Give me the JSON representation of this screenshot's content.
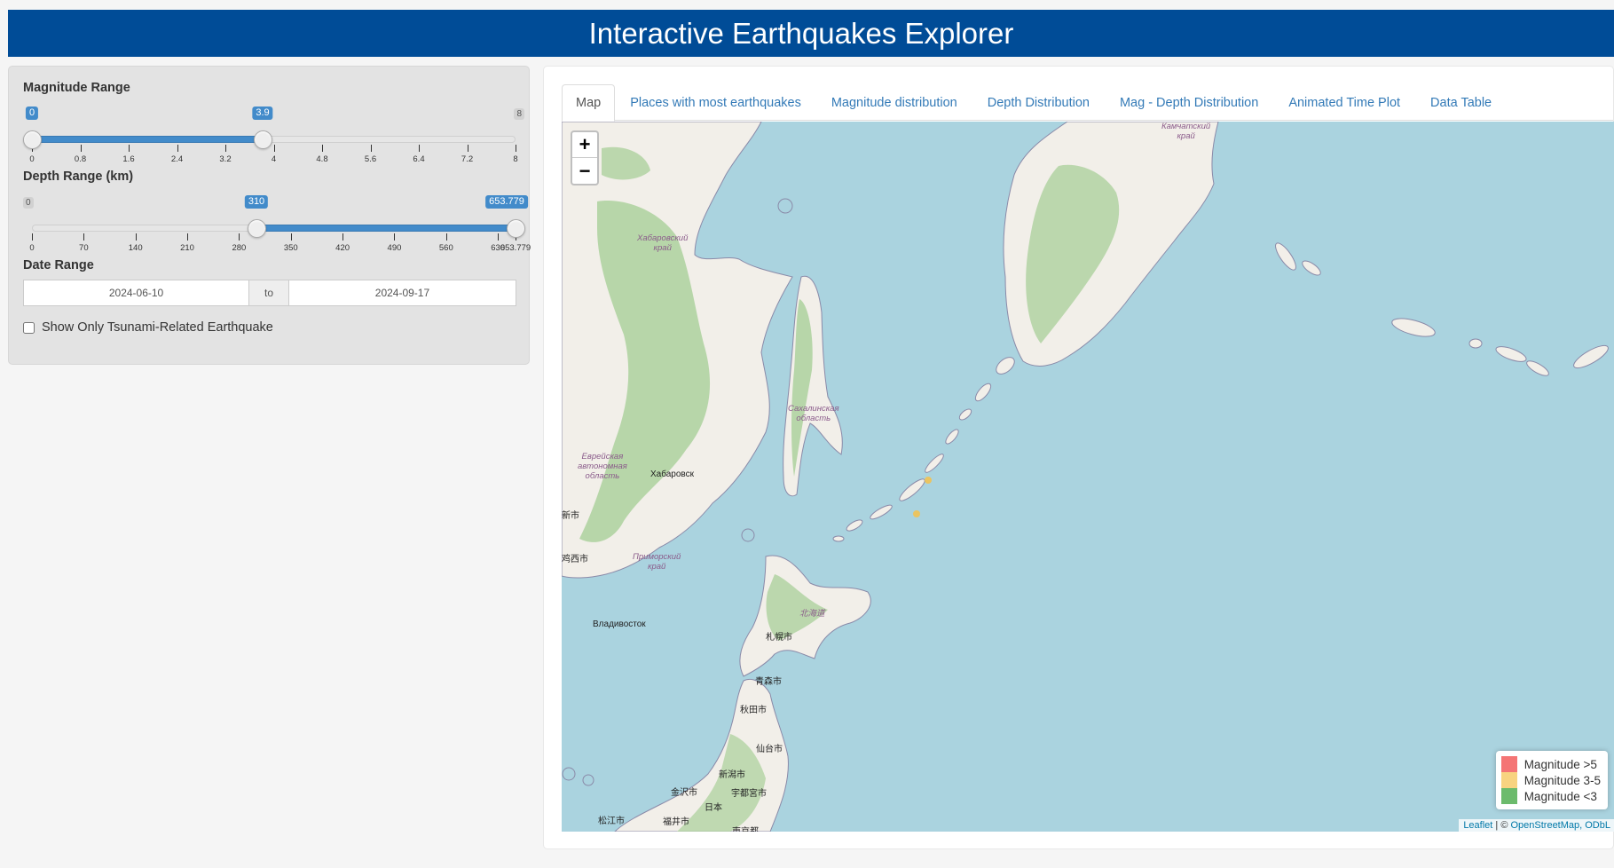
{
  "header": {
    "title": "Interactive Earthquakes Explorer"
  },
  "sidebar": {
    "magnitude": {
      "label": "Magnitude Range",
      "min": "0",
      "max": "8",
      "from": "0",
      "to": "3.9",
      "ticks": [
        "0",
        "0.8",
        "1.6",
        "2.4",
        "3.2",
        "4",
        "4.8",
        "5.6",
        "6.4",
        "7.2",
        "8"
      ]
    },
    "depth": {
      "label": "Depth Range (km)",
      "min": "0",
      "max": "653.779",
      "from": "310",
      "to": "653.779",
      "ticks": [
        "0",
        "70",
        "140",
        "210",
        "280",
        "350",
        "420",
        "490",
        "560",
        "630",
        "653.779"
      ]
    },
    "date": {
      "label": "Date Range",
      "start": "2024-06-10",
      "separator": "to",
      "end": "2024-09-17"
    },
    "tsunami": {
      "label": "Show Only Tsunami-Related Earthquake",
      "checked": false
    }
  },
  "tabs": [
    {
      "label": "Map",
      "active": true
    },
    {
      "label": "Places with most earthquakes"
    },
    {
      "label": "Magnitude distribution"
    },
    {
      "label": "Depth Distribution"
    },
    {
      "label": "Mag - Depth Distribution"
    },
    {
      "label": "Animated Time Plot"
    },
    {
      "label": "Data Table"
    }
  ],
  "map": {
    "zoom_in": "+",
    "zoom_out": "−",
    "place_labels": {
      "kamchatka": "Камчатский\nкрай",
      "khabarovsk_krai": "Хабаровский\nкрай",
      "sakhalin": "Сахалинская\nобласть",
      "jewish_ao": "Еврейская\nавтономная\nобласть",
      "khabarovsk": "Хабаровск",
      "primorsky": "Приморский\nкрай",
      "vladivostok": "Владивосток",
      "hokkaido": "北海道",
      "sapporo": "札幌市",
      "aomori": "青森市",
      "akita": "秋田市",
      "sendai": "仙台市",
      "niigata": "新潟市",
      "kanazawa": "金沢市",
      "utsunomiya": "宇都宮市",
      "japan": "日本",
      "matsue": "松江市",
      "fukui": "福井市",
      "tokyo": "東京都",
      "cn1": "新市",
      "cn2": "鸡西市"
    },
    "earthquakes": [
      {
        "color": "#f6c14b",
        "magnitude_class": "3-5"
      },
      {
        "color": "#f6c14b",
        "magnitude_class": "3-5"
      }
    ],
    "legend": [
      {
        "label": "Magnitude >5",
        "color": "#f03b3b"
      },
      {
        "label": "Magnitude 3-5",
        "color": "#f5c04a"
      },
      {
        "label": "Magnitude <3",
        "color": "#2e9e2e"
      }
    ],
    "attribution": {
      "leaflet": "Leaflet",
      "sep": " | © ",
      "osm": "OpenStreetMap, ODbL"
    }
  },
  "colors": {
    "header_bg": "#004c97",
    "accent": "#428bca",
    "water": "#aad3df",
    "land": "#f2efe9",
    "forest": "#add19e"
  }
}
